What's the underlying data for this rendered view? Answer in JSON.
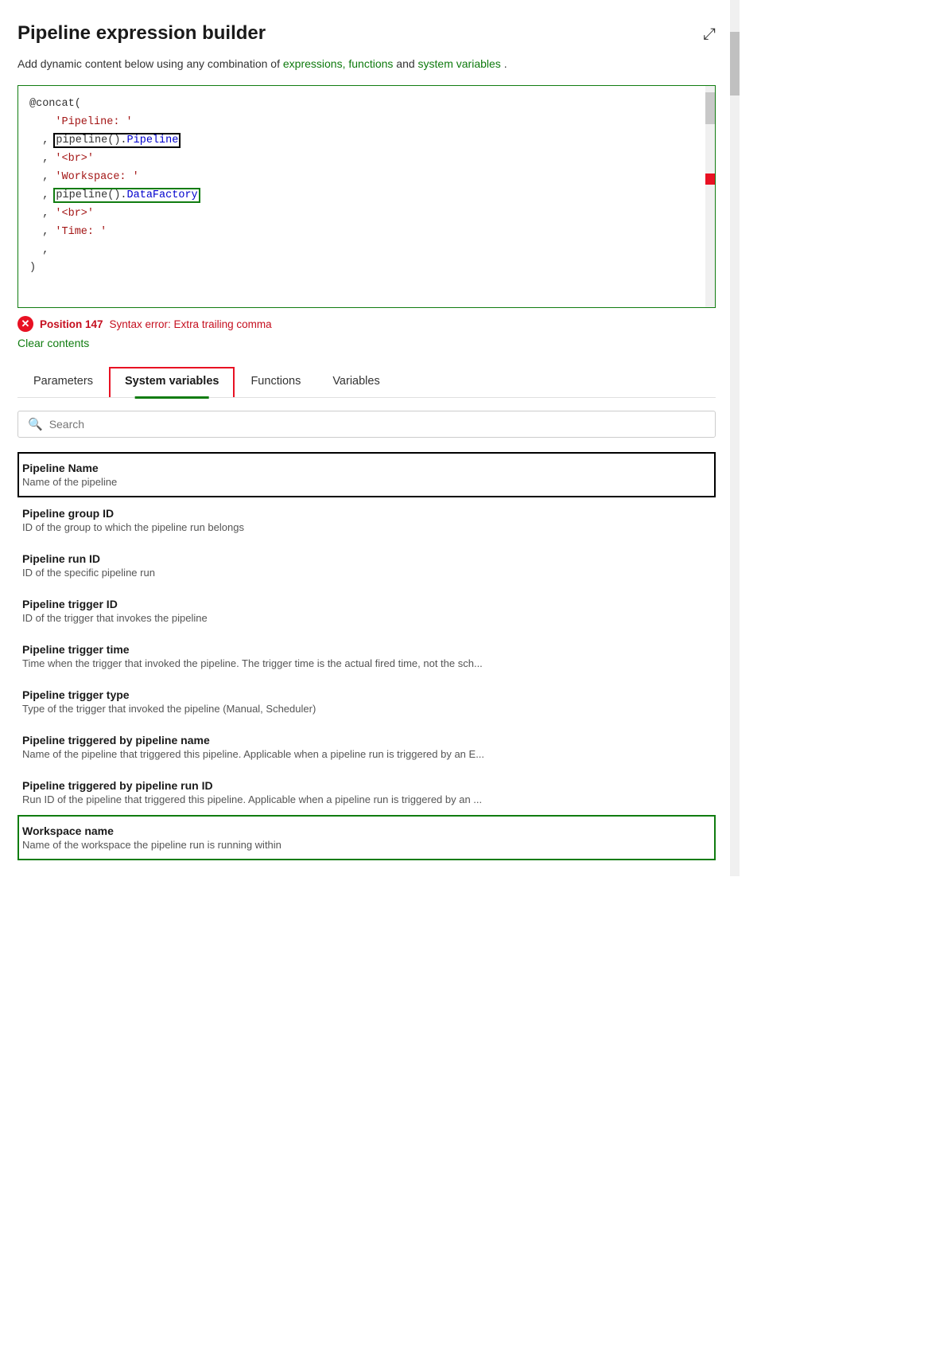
{
  "title": "Pipeline expression builder",
  "expand_icon": "⤢",
  "subtitle": {
    "text_before": "Add dynamic content below using any combination of ",
    "link1": "expressions, functions",
    "text_middle": " and ",
    "link2": "system variables",
    "text_after": "."
  },
  "code_editor": {
    "lines": [
      "@concat(",
      "    'Pipeline: '",
      "  , pipeline().Pipeline",
      "  , '<br>'",
      "  , 'Workspace: '",
      "  , pipeline().DataFactory",
      "  , '<br>'",
      "  , 'Time: '",
      "  ,",
      ")"
    ]
  },
  "error": {
    "position": "Position 147",
    "message": "Syntax error: Extra trailing comma"
  },
  "clear_contents": "Clear contents",
  "tabs": [
    {
      "id": "parameters",
      "label": "Parameters",
      "active": false
    },
    {
      "id": "system-variables",
      "label": "System variables",
      "active": true
    },
    {
      "id": "functions",
      "label": "Functions",
      "active": false
    },
    {
      "id": "variables",
      "label": "Variables",
      "active": false
    }
  ],
  "search_placeholder": "Search",
  "variables": [
    {
      "name": "Pipeline Name",
      "description": "Name of the pipeline",
      "highlight": "black"
    },
    {
      "name": "Pipeline group ID",
      "description": "ID of the group to which the pipeline run belongs",
      "highlight": "none"
    },
    {
      "name": "Pipeline run ID",
      "description": "ID of the specific pipeline run",
      "highlight": "none"
    },
    {
      "name": "Pipeline trigger ID",
      "description": "ID of the trigger that invokes the pipeline",
      "highlight": "none"
    },
    {
      "name": "Pipeline trigger time",
      "description": "Time when the trigger that invoked the pipeline. The trigger time is the actual fired time, not the sch...",
      "highlight": "none"
    },
    {
      "name": "Pipeline trigger type",
      "description": "Type of the trigger that invoked the pipeline (Manual, Scheduler)",
      "highlight": "none"
    },
    {
      "name": "Pipeline triggered by pipeline name",
      "description": "Name of the pipeline that triggered this pipeline. Applicable when a pipeline run is triggered by an E...",
      "highlight": "none"
    },
    {
      "name": "Pipeline triggered by pipeline run ID",
      "description": "Run ID of the pipeline that triggered this pipeline. Applicable when a pipeline run is triggered by an ...",
      "highlight": "none"
    },
    {
      "name": "Workspace name",
      "description": "Name of the workspace the pipeline run is running within",
      "highlight": "green"
    }
  ]
}
